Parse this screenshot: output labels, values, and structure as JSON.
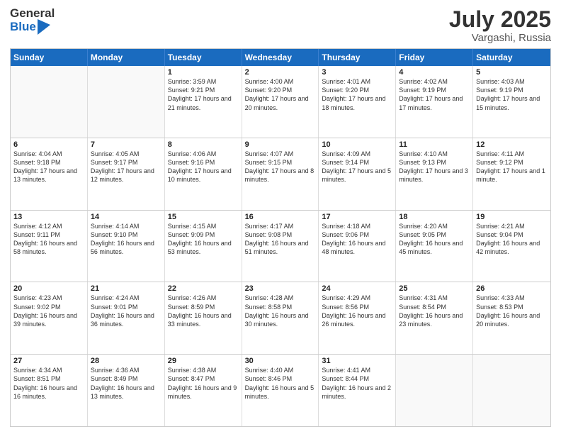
{
  "logo": {
    "general": "General",
    "blue": "Blue"
  },
  "title": {
    "month": "July 2025",
    "location": "Vargashi, Russia"
  },
  "header_days": [
    "Sunday",
    "Monday",
    "Tuesday",
    "Wednesday",
    "Thursday",
    "Friday",
    "Saturday"
  ],
  "rows": [
    [
      {
        "day": "",
        "info": ""
      },
      {
        "day": "",
        "info": ""
      },
      {
        "day": "1",
        "info": "Sunrise: 3:59 AM\nSunset: 9:21 PM\nDaylight: 17 hours and 21 minutes."
      },
      {
        "day": "2",
        "info": "Sunrise: 4:00 AM\nSunset: 9:20 PM\nDaylight: 17 hours and 20 minutes."
      },
      {
        "day": "3",
        "info": "Sunrise: 4:01 AM\nSunset: 9:20 PM\nDaylight: 17 hours and 18 minutes."
      },
      {
        "day": "4",
        "info": "Sunrise: 4:02 AM\nSunset: 9:19 PM\nDaylight: 17 hours and 17 minutes."
      },
      {
        "day": "5",
        "info": "Sunrise: 4:03 AM\nSunset: 9:19 PM\nDaylight: 17 hours and 15 minutes."
      }
    ],
    [
      {
        "day": "6",
        "info": "Sunrise: 4:04 AM\nSunset: 9:18 PM\nDaylight: 17 hours and 13 minutes."
      },
      {
        "day": "7",
        "info": "Sunrise: 4:05 AM\nSunset: 9:17 PM\nDaylight: 17 hours and 12 minutes."
      },
      {
        "day": "8",
        "info": "Sunrise: 4:06 AM\nSunset: 9:16 PM\nDaylight: 17 hours and 10 minutes."
      },
      {
        "day": "9",
        "info": "Sunrise: 4:07 AM\nSunset: 9:15 PM\nDaylight: 17 hours and 8 minutes."
      },
      {
        "day": "10",
        "info": "Sunrise: 4:09 AM\nSunset: 9:14 PM\nDaylight: 17 hours and 5 minutes."
      },
      {
        "day": "11",
        "info": "Sunrise: 4:10 AM\nSunset: 9:13 PM\nDaylight: 17 hours and 3 minutes."
      },
      {
        "day": "12",
        "info": "Sunrise: 4:11 AM\nSunset: 9:12 PM\nDaylight: 17 hours and 1 minute."
      }
    ],
    [
      {
        "day": "13",
        "info": "Sunrise: 4:12 AM\nSunset: 9:11 PM\nDaylight: 16 hours and 58 minutes."
      },
      {
        "day": "14",
        "info": "Sunrise: 4:14 AM\nSunset: 9:10 PM\nDaylight: 16 hours and 56 minutes."
      },
      {
        "day": "15",
        "info": "Sunrise: 4:15 AM\nSunset: 9:09 PM\nDaylight: 16 hours and 53 minutes."
      },
      {
        "day": "16",
        "info": "Sunrise: 4:17 AM\nSunset: 9:08 PM\nDaylight: 16 hours and 51 minutes."
      },
      {
        "day": "17",
        "info": "Sunrise: 4:18 AM\nSunset: 9:06 PM\nDaylight: 16 hours and 48 minutes."
      },
      {
        "day": "18",
        "info": "Sunrise: 4:20 AM\nSunset: 9:05 PM\nDaylight: 16 hours and 45 minutes."
      },
      {
        "day": "19",
        "info": "Sunrise: 4:21 AM\nSunset: 9:04 PM\nDaylight: 16 hours and 42 minutes."
      }
    ],
    [
      {
        "day": "20",
        "info": "Sunrise: 4:23 AM\nSunset: 9:02 PM\nDaylight: 16 hours and 39 minutes."
      },
      {
        "day": "21",
        "info": "Sunrise: 4:24 AM\nSunset: 9:01 PM\nDaylight: 16 hours and 36 minutes."
      },
      {
        "day": "22",
        "info": "Sunrise: 4:26 AM\nSunset: 8:59 PM\nDaylight: 16 hours and 33 minutes."
      },
      {
        "day": "23",
        "info": "Sunrise: 4:28 AM\nSunset: 8:58 PM\nDaylight: 16 hours and 30 minutes."
      },
      {
        "day": "24",
        "info": "Sunrise: 4:29 AM\nSunset: 8:56 PM\nDaylight: 16 hours and 26 minutes."
      },
      {
        "day": "25",
        "info": "Sunrise: 4:31 AM\nSunset: 8:54 PM\nDaylight: 16 hours and 23 minutes."
      },
      {
        "day": "26",
        "info": "Sunrise: 4:33 AM\nSunset: 8:53 PM\nDaylight: 16 hours and 20 minutes."
      }
    ],
    [
      {
        "day": "27",
        "info": "Sunrise: 4:34 AM\nSunset: 8:51 PM\nDaylight: 16 hours and 16 minutes."
      },
      {
        "day": "28",
        "info": "Sunrise: 4:36 AM\nSunset: 8:49 PM\nDaylight: 16 hours and 13 minutes."
      },
      {
        "day": "29",
        "info": "Sunrise: 4:38 AM\nSunset: 8:47 PM\nDaylight: 16 hours and 9 minutes."
      },
      {
        "day": "30",
        "info": "Sunrise: 4:40 AM\nSunset: 8:46 PM\nDaylight: 16 hours and 5 minutes."
      },
      {
        "day": "31",
        "info": "Sunrise: 4:41 AM\nSunset: 8:44 PM\nDaylight: 16 hours and 2 minutes."
      },
      {
        "day": "",
        "info": ""
      },
      {
        "day": "",
        "info": ""
      }
    ]
  ]
}
